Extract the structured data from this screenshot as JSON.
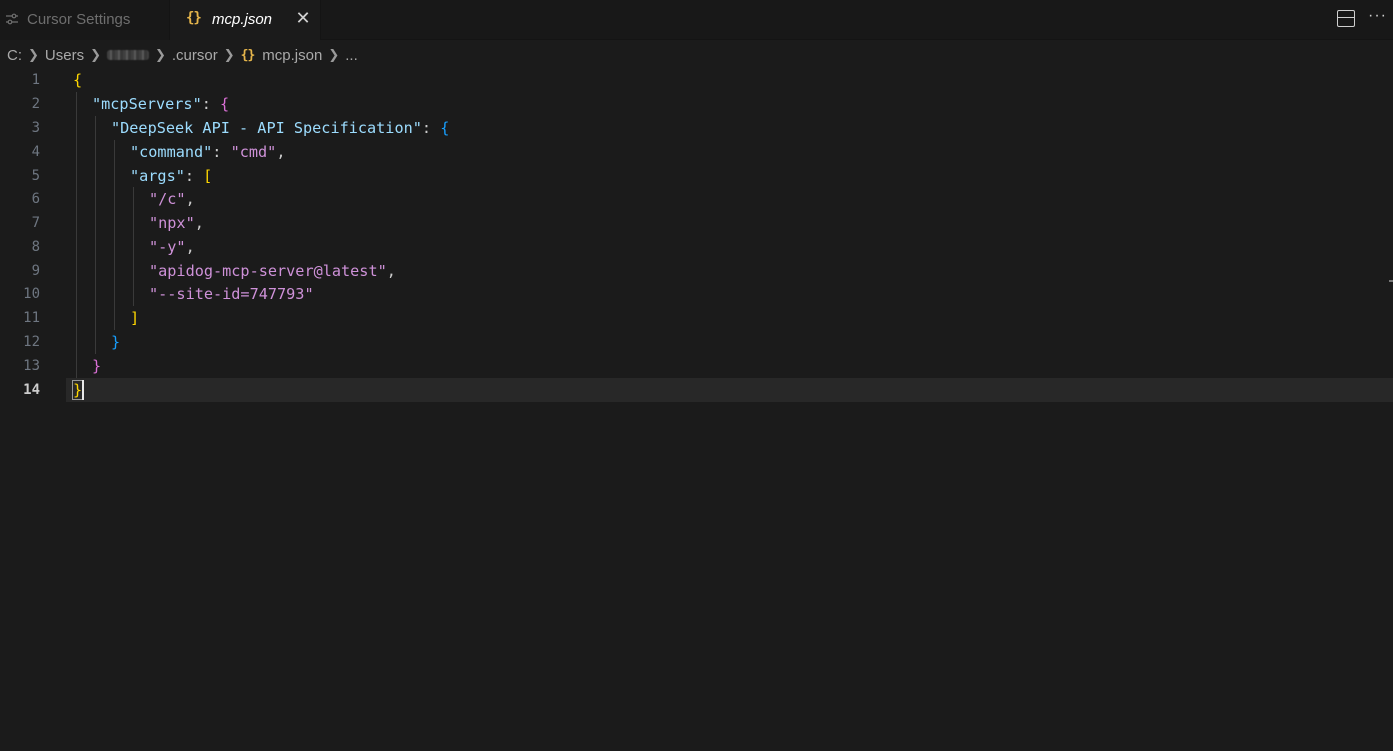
{
  "tabs": [
    {
      "label": "Cursor Settings",
      "icon": "settings-sliders-icon",
      "active": false
    },
    {
      "label": "mcp.json",
      "icon": "json-braces-icon",
      "active": true
    }
  ],
  "tab_actions": {
    "split_icon": "split-editor-icon",
    "more_icon": "more-actions-icon"
  },
  "breadcrumb": {
    "items": [
      "C:",
      "Users",
      "",
      ".cursor",
      "mcp.json",
      "..."
    ]
  },
  "editor": {
    "line_numbers": [
      "1",
      "2",
      "3",
      "4",
      "5",
      "6",
      "7",
      "8",
      "9",
      "10",
      "11",
      "12",
      "13",
      "14"
    ],
    "active_line": "14",
    "tokens": {
      "l1_open": "{",
      "l2_key": "\"mcpServers\"",
      "l2_colon": ": ",
      "l2_open": "{",
      "l3_key": "\"DeepSeek API - API Specification\"",
      "l3_colon": ": ",
      "l3_open": "{",
      "l4_key": "\"command\"",
      "l4_colon": ": ",
      "l4_val": "\"cmd\"",
      "l4_comma": ",",
      "l5_key": "\"args\"",
      "l5_colon": ": ",
      "l5_open": "[",
      "l6_val": "\"/c\"",
      "l6_comma": ",",
      "l7_val": "\"npx\"",
      "l7_comma": ",",
      "l8_val": "\"-y\"",
      "l8_comma": ",",
      "l9_val": "\"apidog-mcp-server@latest\"",
      "l9_comma": ",",
      "l10_val": "\"--site-id=747793\"",
      "l11_close": "]",
      "l12_close": "}",
      "l13_close": "}",
      "l14_close": "}"
    }
  },
  "colors": {
    "key": "#9cdcfe",
    "string": "#ce91d8",
    "bracket_level1": "#ffd700",
    "bracket_level2": "#da70d6",
    "bracket_level3": "#179fff",
    "json_icon": "#e5b54b"
  }
}
